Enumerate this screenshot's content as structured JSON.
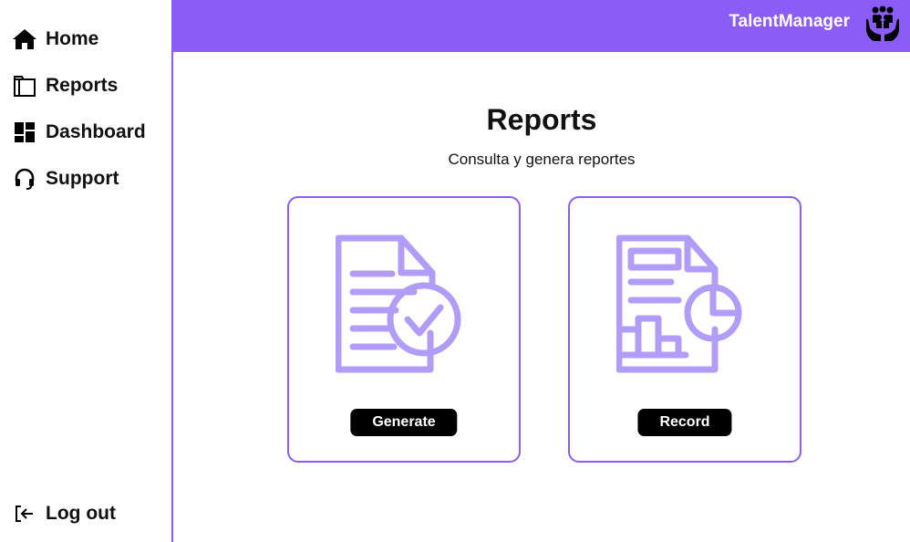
{
  "app": {
    "brand": "TalentManager"
  },
  "sidebar": {
    "items": [
      {
        "label": "Home",
        "icon": "home-icon"
      },
      {
        "label": "Reports",
        "icon": "folder-icon"
      },
      {
        "label": "Dashboard",
        "icon": "dashboard-icon"
      },
      {
        "label": "Support",
        "icon": "headset-icon"
      }
    ],
    "logout": {
      "label": "Log out",
      "icon": "logout-icon"
    }
  },
  "main": {
    "title": "Reports",
    "subtitle": "Consulta y genera reportes",
    "cards": [
      {
        "button_label": "Generate",
        "icon": "document-check-icon"
      },
      {
        "button_label": "Record",
        "icon": "document-chart-icon"
      }
    ]
  },
  "colors": {
    "accent": "#8b5cf6",
    "illustration": "#b19cf7",
    "button": "#000000"
  }
}
